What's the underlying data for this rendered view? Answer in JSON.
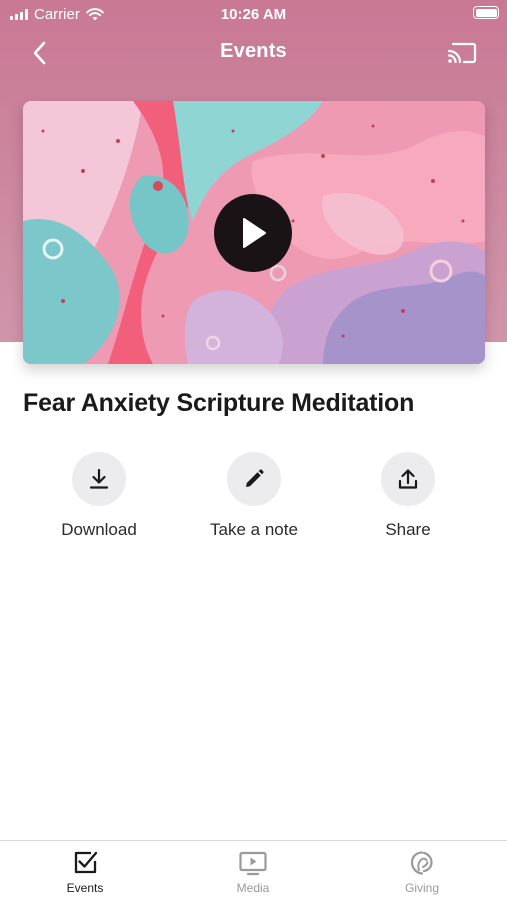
{
  "status_bar": {
    "carrier": "Carrier",
    "time": "10:26 AM"
  },
  "nav": {
    "title": "Events",
    "back_icon": "chevron-left-icon",
    "cast_icon": "cast-icon"
  },
  "video": {
    "play_icon": "play-icon"
  },
  "event": {
    "title": "Fear Anxiety Scripture Meditation"
  },
  "actions": [
    {
      "label": "Download",
      "icon": "download-icon"
    },
    {
      "label": "Take a note",
      "icon": "pencil-icon"
    },
    {
      "label": "Share",
      "icon": "share-icon"
    }
  ],
  "tabs": [
    {
      "label": "Events",
      "icon": "checkbox-icon",
      "active": true
    },
    {
      "label": "Media",
      "icon": "tv-play-icon",
      "active": false
    },
    {
      "label": "Giving",
      "icon": "giving-icon",
      "active": false
    }
  ],
  "colors": {
    "header": "#c97894",
    "text": "#1a1a1a",
    "inactive_tab": "#9a9a9a",
    "action_circle": "#ececee"
  }
}
